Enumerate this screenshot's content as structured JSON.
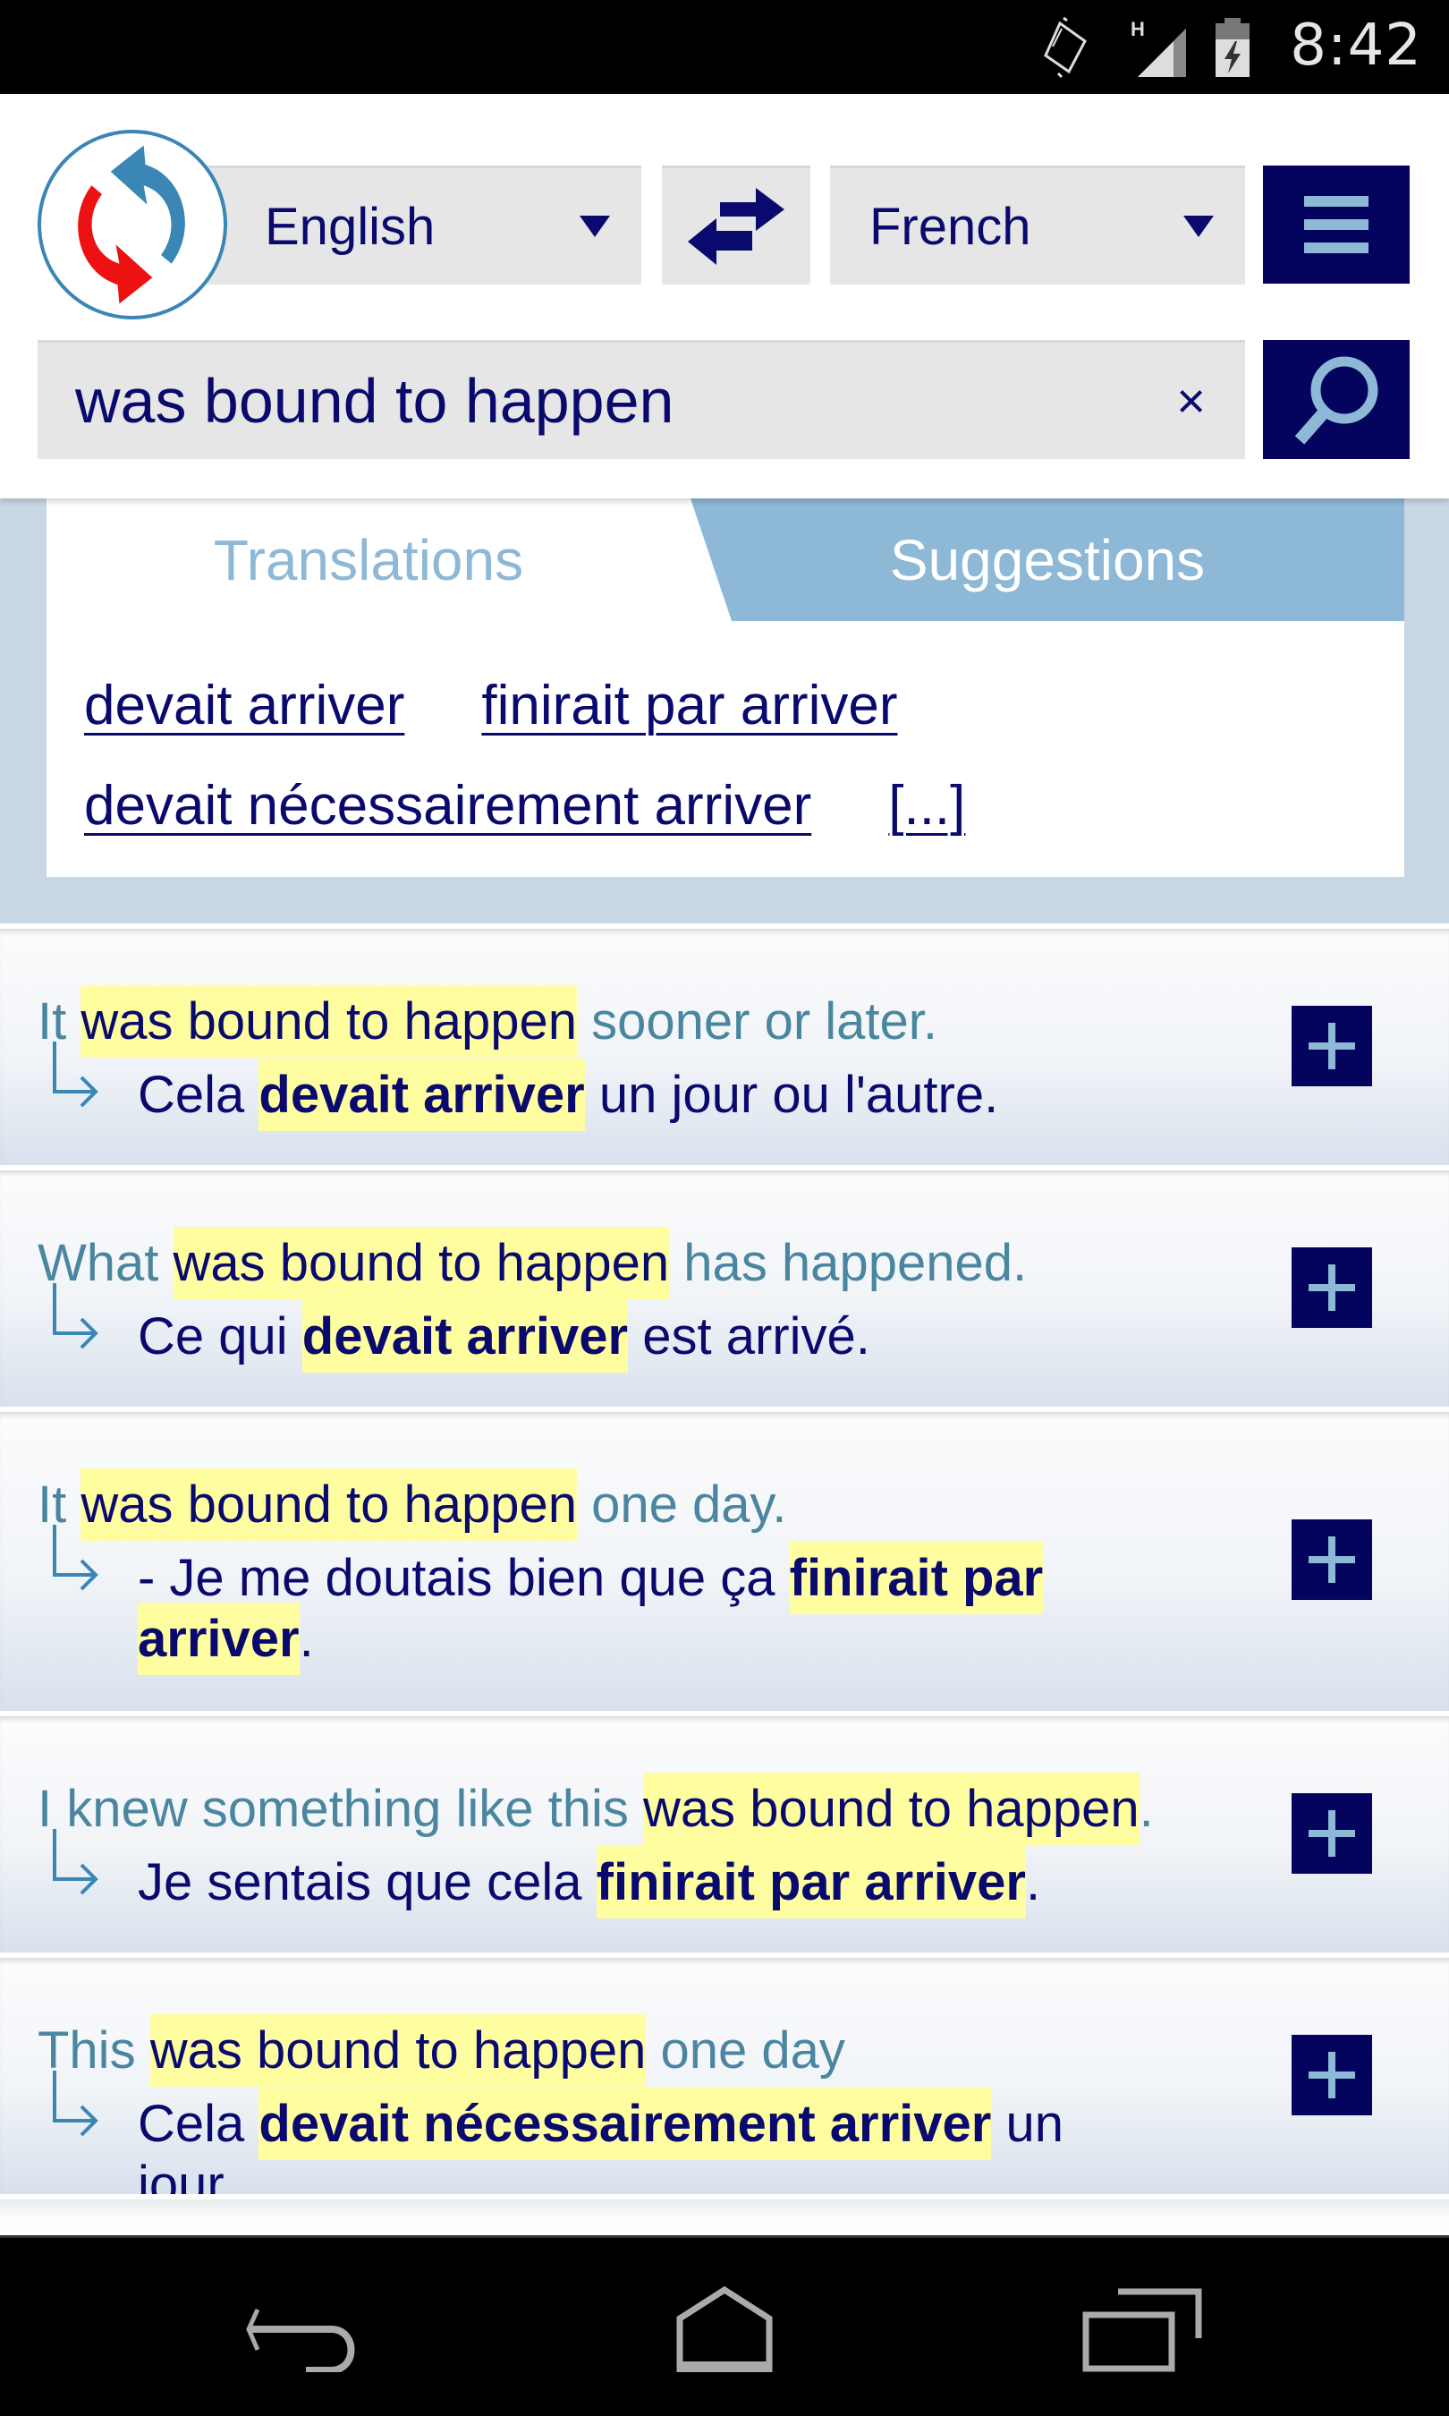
{
  "status_bar": {
    "time": "8:42",
    "network_type": "H",
    "icons": [
      "screen-rotation-icon",
      "signal-icon",
      "battery-charging-icon"
    ]
  },
  "header": {
    "logo": "app-logo-refresh-arrows",
    "source_language": "English",
    "target_language": "French",
    "swap_icon": "swap-arrows-icon",
    "menu_icon": "hamburger-menu-icon",
    "search": {
      "value": "was bound to happen",
      "clear_label": "×",
      "search_icon": "magnifier-icon"
    }
  },
  "tabs": [
    {
      "label": "Translations",
      "active": false
    },
    {
      "label": "Suggestions",
      "active": true
    }
  ],
  "translation_links": [
    "devait arriver",
    "finirait par arriver",
    "devait nécessairement arriver",
    "[...]"
  ],
  "results": [
    {
      "source": {
        "before": "It ",
        "match": "was bound to happen",
        "after": " sooner or later."
      },
      "translation": {
        "before": "Cela ",
        "match": "devait arriver",
        "after": " un jour ou l'autre."
      }
    },
    {
      "source": {
        "before": "What ",
        "match": "was bound to happen",
        "after": " has happened."
      },
      "translation": {
        "before": "Ce qui ",
        "match": "devait arriver",
        "after": " est arrivé."
      }
    },
    {
      "source": {
        "before": "It ",
        "match": "was bound to happen",
        "after": " one day."
      },
      "translation": {
        "before": "- Je me doutais bien que ça ",
        "match": "finirait par arriver",
        "after": "."
      }
    },
    {
      "source": {
        "before": "I knew something like this ",
        "match": "was bound to happen",
        "after": "."
      },
      "translation": {
        "before": "Je sentais que cela ",
        "match": "finirait par arriver",
        "after": "."
      }
    },
    {
      "source": {
        "before": "This ",
        "match": "was bound to happen",
        "after": " one day"
      },
      "translation": {
        "before": "Cela ",
        "match": "devait nécessairement arriver",
        "after": " un jour."
      }
    }
  ],
  "add_button_label": "+",
  "nav_bar": [
    "back-icon",
    "home-icon",
    "recent-apps-icon"
  ],
  "colors": {
    "navy": "#04045e",
    "text_navy": "#0a0a6e",
    "light_blue": "#8db8d6",
    "source_text": "#4a86a0",
    "highlight": "#fefea0",
    "panel_bg": "#c9d6e4"
  }
}
